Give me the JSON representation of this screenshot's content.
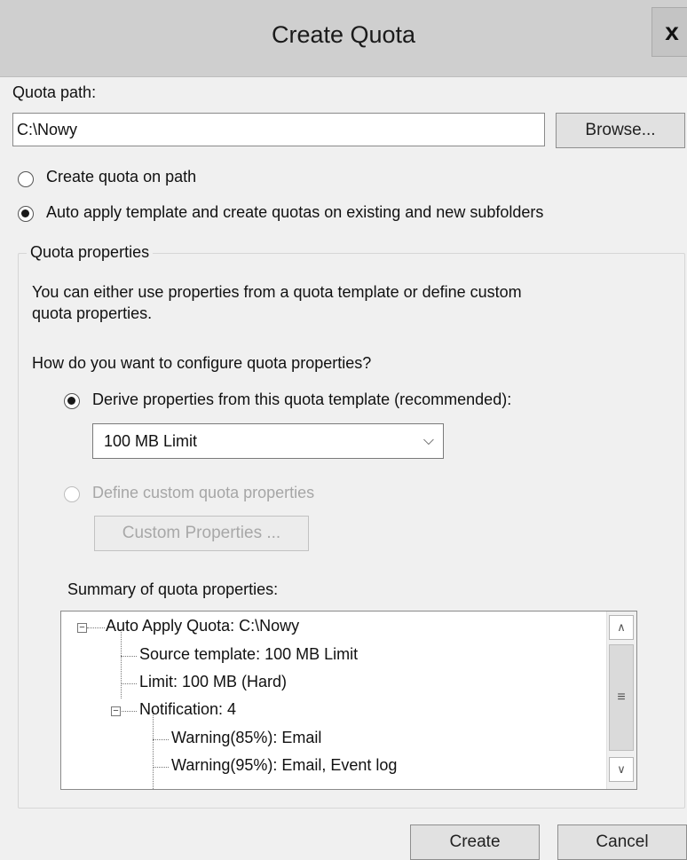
{
  "window": {
    "title": "Create Quota",
    "close_label": "x"
  },
  "quota_path": {
    "label": "Quota path:",
    "value": "C:\\Nowy",
    "browse_label": "Browse..."
  },
  "mode_options": {
    "create_on_path": "Create quota on path",
    "auto_apply": "Auto apply template and create quotas on existing and new subfolders",
    "selected": "auto_apply"
  },
  "properties": {
    "group_label": "Quota properties",
    "description_line1": "You can either use properties from a quota template or define custom",
    "description_line2": "quota properties.",
    "question": "How do you want to configure quota properties?",
    "derive_label": "Derive properties from this quota template (recommended):",
    "template_selected": "100 MB Limit",
    "custom_label": "Define custom quota properties",
    "custom_button": "Custom Properties ...",
    "selected": "derive"
  },
  "summary": {
    "label": "Summary of quota properties:",
    "tree": {
      "root": "Auto Apply Quota: C:\\Nowy",
      "source_template": "Source template: 100 MB Limit",
      "limit": "Limit: 100 MB (Hard)",
      "notification": "Notification: 4",
      "warning_85": "Warning(85%): Email",
      "warning_95": "Warning(95%): Email, Event log"
    }
  },
  "buttons": {
    "create": "Create",
    "cancel": "Cancel"
  },
  "icons": {
    "radio_checked": "radio-checked",
    "radio_unchecked": "radio-unchecked",
    "dropdown": "chevron-down-icon",
    "tree_collapse": "minus-box-icon",
    "scroll_up": "arrow-up-icon",
    "scroll_down": "arrow-down-icon"
  }
}
